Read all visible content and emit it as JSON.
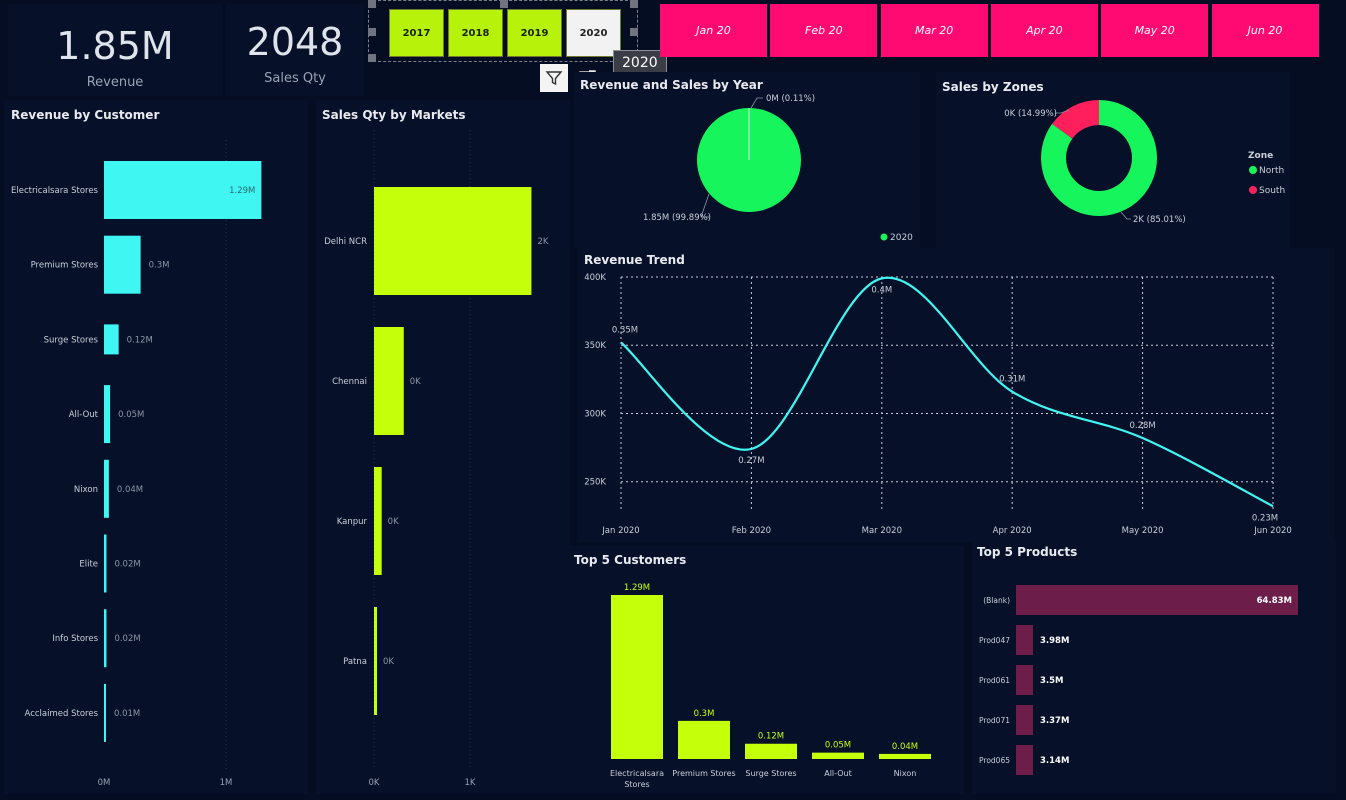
{
  "kpis": {
    "revenue_value": "1.85M",
    "revenue_label": "Revenue",
    "qty_value": "2048",
    "qty_label": "Sales Qty"
  },
  "year_slicer": {
    "years": [
      "2017",
      "2018",
      "2019",
      "2020"
    ],
    "selected": "2020",
    "tooltip": "2020",
    "active_color": "#b6f20a",
    "selected_color": "#f2f2f2"
  },
  "month_slicer": {
    "months": [
      "Jan 20",
      "Feb 20",
      "Mar 20",
      "Apr 20",
      "May 20",
      "Jun 20"
    ],
    "color": "#ff0a73"
  },
  "visual_header_icons": [
    "filter-icon",
    "focus-mode-icon"
  ],
  "colors": {
    "cyan": "#40f6f2",
    "lime": "#c6ff0a",
    "green": "#17f55d",
    "pink": "#ff1f5d",
    "maroon": "#6d1d4a",
    "background": "#050d22",
    "panel": "#061129"
  },
  "chart_data": [
    {
      "id": "revenue_by_customer",
      "type": "bar",
      "orientation": "horizontal",
      "title": "Revenue by Customer",
      "categories": [
        "Electricalsara Stores",
        "Premium Stores",
        "Surge Stores",
        "All-Out",
        "Nixon",
        "Elite",
        "Info Stores",
        "Acclaimed Stores"
      ],
      "values": [
        1.29,
        0.3,
        0.12,
        0.05,
        0.04,
        0.02,
        0.02,
        0.01
      ],
      "labels": [
        "1.29M",
        "0.3M",
        "0.12M",
        "0.05M",
        "0.04M",
        "0.02M",
        "0.02M",
        "0.01M"
      ],
      "x_ticks": [
        "0M",
        "1M"
      ],
      "xlim": [
        0,
        1.5
      ],
      "unit": "M"
    },
    {
      "id": "sales_qty_by_markets",
      "type": "bar",
      "orientation": "horizontal",
      "title": "Sales Qty by Markets",
      "categories": [
        "Delhi NCR",
        "Chennai",
        "Kanpur",
        "Patna"
      ],
      "values": [
        1640,
        310,
        80,
        18
      ],
      "labels": [
        "2K",
        "0K",
        "0K",
        "0K"
      ],
      "x_ticks": [
        "0K",
        "1K"
      ],
      "xlim": [
        0,
        2000
      ]
    },
    {
      "id": "revenue_and_sales_by_year",
      "type": "pie",
      "title": "Revenue and Sales by Year",
      "slices": [
        {
          "label": "1.85M (99.89%)",
          "value": 99.89
        },
        {
          "label": "0M (0.11%)",
          "value": 0.11
        }
      ],
      "legend": [
        "2020"
      ]
    },
    {
      "id": "sales_by_zones",
      "type": "pie",
      "donut": true,
      "title": "Sales by Zones",
      "slices": [
        {
          "name": "North",
          "label": "2K (85.01%)",
          "value": 85.01
        },
        {
          "name": "South",
          "label": "0K (14.99%)",
          "value": 14.99
        }
      ],
      "legend_title": "Zone",
      "legend": [
        "North",
        "South"
      ]
    },
    {
      "id": "revenue_trend",
      "type": "line",
      "title": "Revenue Trend",
      "x": [
        "Jan 2020",
        "Feb 2020",
        "Mar 2020",
        "Apr 2020",
        "May 2020",
        "Jun 2020"
      ],
      "values": [
        352000,
        274000,
        399000,
        316000,
        282000,
        232000
      ],
      "labels": [
        "0.35M",
        "0.27M",
        "0.4M",
        "0.31M",
        "0.28M",
        "0.23M"
      ],
      "y_ticks": [
        "400K",
        "350K",
        "300K",
        "250K"
      ],
      "ylim": [
        230000,
        400000
      ],
      "grid": true
    },
    {
      "id": "top_5_customers",
      "type": "bar",
      "title": "Top 5 Customers",
      "categories": [
        "Electricalsara Stores",
        "Premium Stores",
        "Surge Stores",
        "All-Out",
        "Nixon"
      ],
      "values": [
        1.29,
        0.3,
        0.12,
        0.05,
        0.04
      ],
      "labels": [
        "1.29M",
        "0.3M",
        "0.12M",
        "0.05M",
        "0.04M"
      ]
    },
    {
      "id": "top_5_products",
      "type": "bar",
      "orientation": "horizontal",
      "title": "Top 5 Products",
      "categories": [
        "(Blank)",
        "Prod047",
        "Prod061",
        "Prod071",
        "Prod065"
      ],
      "values": [
        64.83,
        3.98,
        3.5,
        3.37,
        3.14
      ],
      "labels": [
        "64.83M",
        "3.98M",
        "3.5M",
        "3.37M",
        "3.14M"
      ]
    }
  ]
}
